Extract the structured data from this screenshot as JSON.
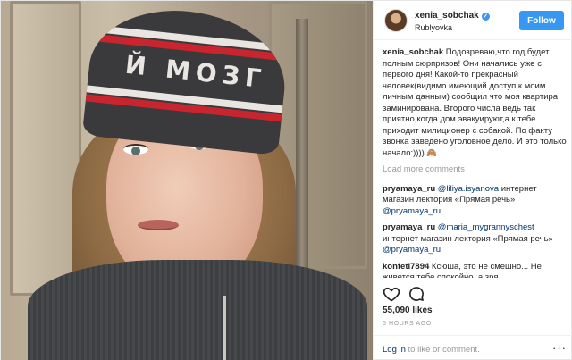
{
  "post": {
    "beanie_text": "Й МОЗГ",
    "header": {
      "username": "xenia_sobchak",
      "verified_mark": "✓",
      "location": "Rublyovka",
      "follow_label": "Follow"
    },
    "caption": {
      "username": "xenia_sobchak",
      "text": "Подозреваю,что год будет полным сюрпризов! Они начались уже с первого дня! Какой-то прекрасный человек(видимо имеющий доступ к моим личным данным) сообщил что моя квартира заминирована. Второго числа ведь так приятно,когда дом эвакуируют,а к тебе приходит милиционер с собакой. По факту звонка заведено уголовное дело. И это только начало:)))) 🙈"
    },
    "load_more_label": "Load more comments",
    "comments": [
      {
        "username": "pryamaya_ru",
        "mention": "@liliya.isyanova",
        "text": " интернет магазин лектория «Прямая речь» ",
        "mention2": "@pryamaya_ru"
      },
      {
        "username": "pryamaya_ru",
        "mention": "@maria_mygrannyschest",
        "text": " интернет магазин лектория «Прямая речь» ",
        "mention2": "@pryamaya_ru"
      },
      {
        "username": "konfeti7894",
        "text": "Ксюша, это не смешно... Не живется тебе спокойно, а зря..."
      }
    ],
    "icons": {
      "like": "heart-icon",
      "comment": "comment-icon",
      "more": "more-options-icon"
    },
    "likes": "55,090 likes",
    "timestamp": "5 HOURS AGO",
    "footer": {
      "login_link": "Log in",
      "login_rest": " to like or comment.",
      "more_glyph": "···"
    }
  }
}
